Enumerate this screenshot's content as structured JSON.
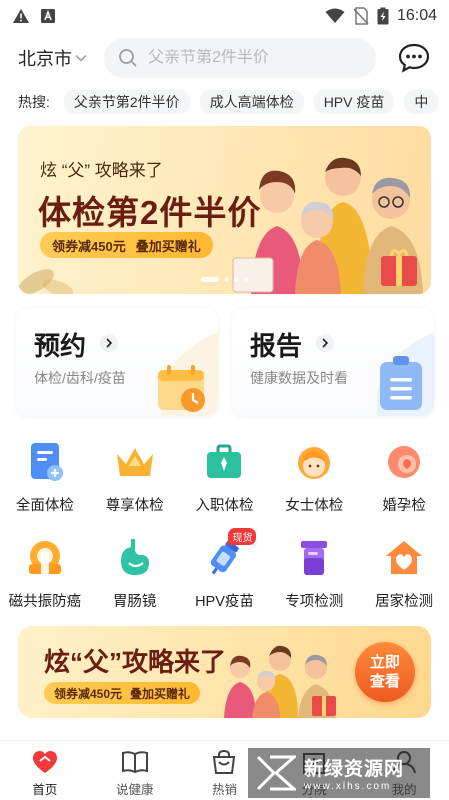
{
  "status_bar": {
    "time": "16:04",
    "icons": [
      "warning-icon",
      "a-icon",
      "wifi-icon",
      "no-sim-icon",
      "battery-icon"
    ]
  },
  "header": {
    "city": "北京市",
    "search_placeholder": "父亲节第2件半价",
    "message_icon": "chat-bubble-icon"
  },
  "hot_search": {
    "label": "热搜:",
    "items": [
      "父亲节第2件半价",
      "成人高端体检",
      "HPV 疫苗",
      "中"
    ]
  },
  "banner": {
    "small_title": "炫 “父” 攻略来了",
    "big_title": "体检第2件半价",
    "promo_left": "领券减450元",
    "promo_right": "叠加买赠礼",
    "dots": 4,
    "active_dot": 0
  },
  "cards": [
    {
      "title": "预约",
      "subtitle": "体检/齿科/疫苗",
      "icon": "calendar-clock-icon"
    },
    {
      "title": "报告",
      "subtitle": "健康数据及时看",
      "icon": "clipboard-icon"
    }
  ],
  "grid": [
    {
      "label": "全面体检",
      "icon": "document-plus-icon"
    },
    {
      "label": "尊享体检",
      "icon": "crown-icon"
    },
    {
      "label": "入职体检",
      "icon": "briefcase-icon"
    },
    {
      "label": "女士体检",
      "icon": "woman-icon"
    },
    {
      "label": "婚孕检",
      "icon": "pregnancy-icon"
    },
    {
      "label": "磁共振防癌",
      "icon": "mri-icon"
    },
    {
      "label": "胃肠镜",
      "icon": "stomach-icon"
    },
    {
      "label": "HPV疫苗",
      "icon": "vaccine-icon",
      "badge": "现货"
    },
    {
      "label": "专项检测",
      "icon": "test-tube-icon"
    },
    {
      "label": "居家检测",
      "icon": "home-heart-icon"
    }
  ],
  "banner2": {
    "title": "炫“父”攻略来了",
    "promo_left": "领券减450元",
    "promo_right": "叠加买赠礼",
    "cta_line1": "立即",
    "cta_line2": "查看"
  },
  "tabbar": [
    {
      "label": "首页",
      "icon": "heart-home-icon",
      "active": true
    },
    {
      "label": "说健康",
      "icon": "book-icon",
      "active": false
    },
    {
      "label": "热销",
      "icon": "shopping-bag-icon",
      "active": false
    },
    {
      "label": "分院",
      "icon": "hospital-icon",
      "active": false
    },
    {
      "label": "我的",
      "icon": "user-icon",
      "active": false
    }
  ],
  "watermark": {
    "text": "新绿资源网",
    "url": "www.xlhs.com"
  },
  "colors": {
    "accent": "#f2383b",
    "banner_title": "#6a1d10",
    "promo_gold": "#ffb830"
  }
}
